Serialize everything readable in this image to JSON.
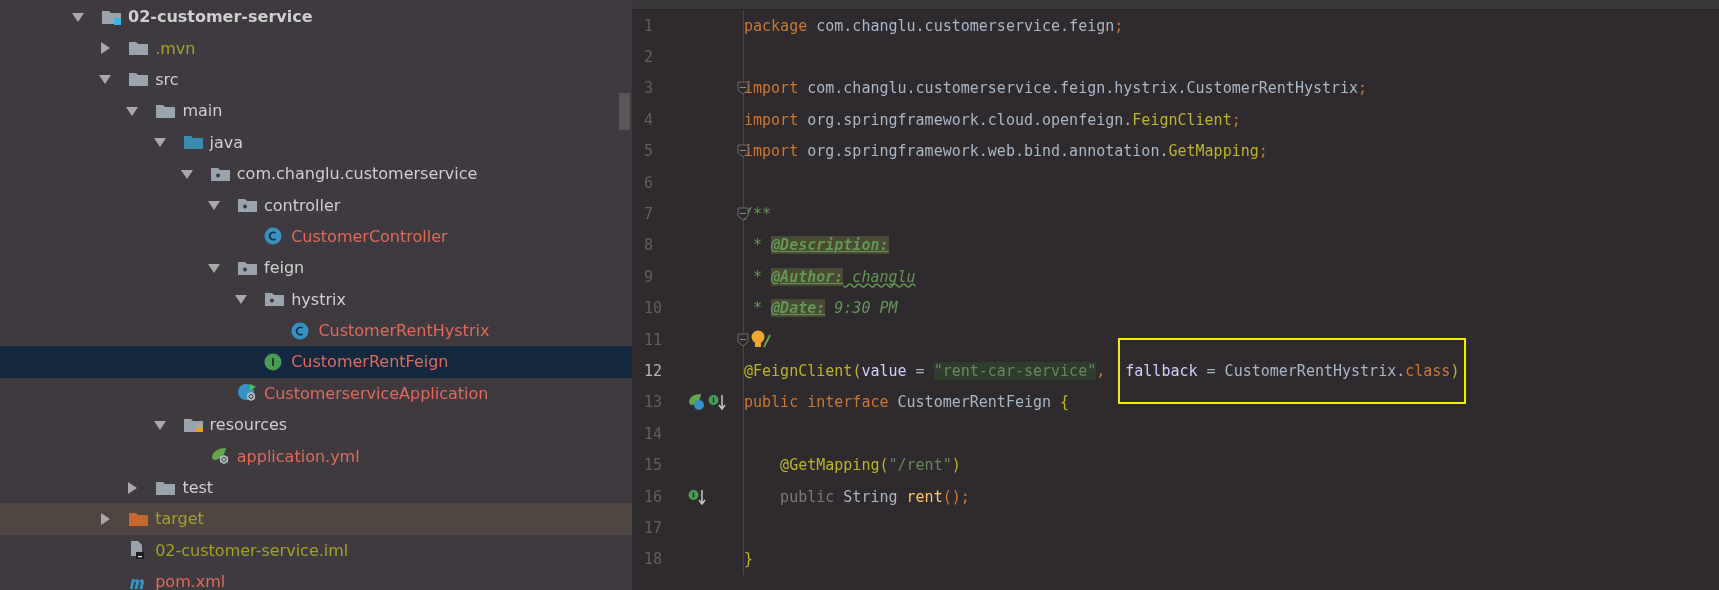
{
  "project_tree": {
    "items": [
      {
        "label": "02-customer-service",
        "kind": "project",
        "color": "#cfcfcf",
        "expanded": true,
        "selected": false,
        "children": [
          {
            "label": ".mvn",
            "kind": "folder",
            "color": "#a2a320",
            "expanded": false,
            "selected": false
          },
          {
            "label": "src",
            "kind": "folder",
            "color": "#cfcfcf",
            "expanded": true,
            "selected": false,
            "children": [
              {
                "label": "main",
                "kind": "folder",
                "color": "#cfcfcf",
                "expanded": true,
                "selected": false,
                "children": [
                  {
                    "label": "java",
                    "kind": "source",
                    "color": "#cfcfcf",
                    "expanded": true,
                    "selected": false,
                    "children": [
                      {
                        "label": "com.changlu.customerservice",
                        "kind": "package",
                        "color": "#cfcfcf",
                        "expanded": true,
                        "selected": false,
                        "children": [
                          {
                            "label": "controller",
                            "kind": "package",
                            "color": "#cfcfcf",
                            "expanded": true,
                            "selected": false,
                            "children": [
                              {
                                "label": "CustomerController",
                                "kind": "class",
                                "color": "#e0695a",
                                "selected": false
                              }
                            ]
                          },
                          {
                            "label": "feign",
                            "kind": "package",
                            "color": "#cfcfcf",
                            "expanded": true,
                            "selected": false,
                            "children": [
                              {
                                "label": "hystrix",
                                "kind": "package",
                                "color": "#cfcfcf",
                                "expanded": true,
                                "selected": false,
                                "children": [
                                  {
                                    "label": "CustomerRentHystrix",
                                    "kind": "class",
                                    "color": "#e0695a",
                                    "selected": false
                                  }
                                ]
                              },
                              {
                                "label": "CustomerRentFeign",
                                "kind": "interface",
                                "color": "#e0695a",
                                "selected": true
                              }
                            ]
                          },
                          {
                            "label": "CustomerserviceApplication",
                            "kind": "app",
                            "color": "#e0695a",
                            "selected": false
                          }
                        ]
                      }
                    ]
                  },
                  {
                    "label": "resources",
                    "kind": "resources",
                    "color": "#cfcfcf",
                    "expanded": true,
                    "selected": false,
                    "children": [
                      {
                        "label": "application.yml",
                        "kind": "yml",
                        "color": "#e0695a",
                        "selected": false
                      }
                    ]
                  }
                ]
              },
              {
                "label": "test",
                "kind": "folder",
                "color": "#cfcfcf",
                "expanded": false,
                "selected": false
              }
            ]
          },
          {
            "label": "target",
            "kind": "excluded",
            "color": "#a2a320",
            "expanded": false,
            "selected": false
          },
          {
            "label": "02-customer-service.iml",
            "kind": "iml",
            "color": "#a2a320",
            "selected": false
          },
          {
            "label": "pom.xml",
            "kind": "maven",
            "color": "#e0695a",
            "selected": false
          }
        ]
      }
    ]
  },
  "editor": {
    "lines": [
      {
        "number": "1",
        "current": false,
        "parts": [
          {
            "highlighted": false,
            "tokens": [
              {
                "text": "package",
                "kind": "keyword"
              },
              {
                "text": " com.changlu.customerservice.feign",
                "kind": "plain"
              },
              {
                "text": ";",
                "kind": "keyword"
              }
            ]
          }
        ]
      },
      {
        "number": "2",
        "current": false
      },
      {
        "number": "3",
        "current": false,
        "parts": [
          {
            "highlighted": false,
            "tokens": [
              {
                "text": "import",
                "kind": "keyword"
              },
              {
                "text": " com.changlu.customerservice.feign.hystrix.CustomerRentHystrix",
                "kind": "plain"
              },
              {
                "text": ";",
                "kind": "keyword"
              }
            ]
          }
        ]
      },
      {
        "number": "4",
        "current": false,
        "parts": [
          {
            "highlighted": false,
            "tokens": [
              {
                "text": "import",
                "kind": "keyword"
              },
              {
                "text": " org.springframework.cloud.openfeign.",
                "kind": "plain"
              },
              {
                "text": "FeignClient",
                "kind": "annotation"
              },
              {
                "text": ";",
                "kind": "keyword"
              }
            ]
          }
        ]
      },
      {
        "number": "5",
        "current": false,
        "parts": [
          {
            "highlighted": false,
            "tokens": [
              {
                "text": "import",
                "kind": "keyword"
              },
              {
                "text": " org.springframework.web.bind.annotation.",
                "kind": "plain"
              },
              {
                "text": "GetMapping",
                "kind": "annotation"
              },
              {
                "text": ";",
                "kind": "keyword"
              }
            ]
          }
        ]
      },
      {
        "number": "6",
        "current": false
      },
      {
        "number": "7",
        "current": false,
        "parts": [
          {
            "highlighted": false,
            "tokens": [
              {
                "text": "/**",
                "kind": "comment"
              }
            ]
          }
        ]
      },
      {
        "number": "8",
        "current": false,
        "parts": [
          {
            "highlighted": false,
            "tokens": [
              {
                "text": " * ",
                "kind": "comment"
              },
              {
                "text": "@Description:",
                "kind": "doctag"
              }
            ]
          }
        ]
      },
      {
        "number": "9",
        "current": false,
        "parts": [
          {
            "highlighted": false,
            "tokens": [
              {
                "text": " * ",
                "kind": "comment"
              },
              {
                "text": "@Author:",
                "kind": "doctag"
              },
              {
                "text": " changlu",
                "kind": "typo"
              }
            ]
          }
        ]
      },
      {
        "number": "10",
        "current": false,
        "parts": [
          {
            "highlighted": false,
            "tokens": [
              {
                "text": " * ",
                "kind": "comment"
              },
              {
                "text": "@Date:",
                "kind": "doctag"
              },
              {
                "text": " 9:30 PM",
                "kind": "comment"
              }
            ]
          }
        ]
      },
      {
        "number": "11",
        "current": false
      },
      {
        "number": "12",
        "current": true,
        "parts": [
          {
            "highlighted": false,
            "tokens": [
              {
                "text": "@FeignClient",
                "kind": "annotation"
              },
              {
                "text": "(",
                "kind": "annotation"
              },
              {
                "text": "value",
                "kind": "param"
              },
              {
                "text": " = ",
                "kind": "plain"
              },
              {
                "text": "\"rent-car-service\"",
                "kind": "injected"
              },
              {
                "text": ", ",
                "kind": "keyword"
              }
            ]
          },
          {
            "highlighted": true,
            "tokens": [
              {
                "text": "fallback",
                "kind": "param"
              },
              {
                "text": " = CustomerRentHystrix.",
                "kind": "plain"
              },
              {
                "text": "class",
                "kind": "keyword"
              },
              {
                "text": ")",
                "kind": "annotation"
              }
            ]
          }
        ]
      },
      {
        "number": "13",
        "current": false,
        "parts": [
          {
            "highlighted": false,
            "tokens": [
              {
                "text": "public interface",
                "kind": "keyword"
              },
              {
                "text": " CustomerRentFeign ",
                "kind": "plain"
              },
              {
                "text": "{",
                "kind": "annotation"
              }
            ]
          }
        ]
      },
      {
        "number": "14",
        "current": false
      },
      {
        "number": "15",
        "current": false,
        "parts": [
          {
            "highlighted": false,
            "tokens": [
              {
                "text": "    @GetMapping",
                "kind": "annotation"
              },
              {
                "text": "(",
                "kind": "annotation"
              },
              {
                "text": "\"/rent\"",
                "kind": "string"
              },
              {
                "text": ")",
                "kind": "annotation"
              }
            ]
          }
        ]
      },
      {
        "number": "16",
        "current": false,
        "parts": [
          {
            "highlighted": false,
            "tokens": [
              {
                "text": "    public",
                "kind": "muted"
              },
              {
                "text": " String ",
                "kind": "plain"
              },
              {
                "text": "rent",
                "kind": "method"
              },
              {
                "text": "();",
                "kind": "keyword"
              }
            ]
          }
        ]
      },
      {
        "number": "17",
        "current": false
      },
      {
        "number": "18",
        "current": false,
        "parts": [
          {
            "highlighted": false,
            "tokens": [
              {
                "text": "}",
                "kind": "annotation"
              }
            ]
          }
        ]
      }
    ]
  }
}
